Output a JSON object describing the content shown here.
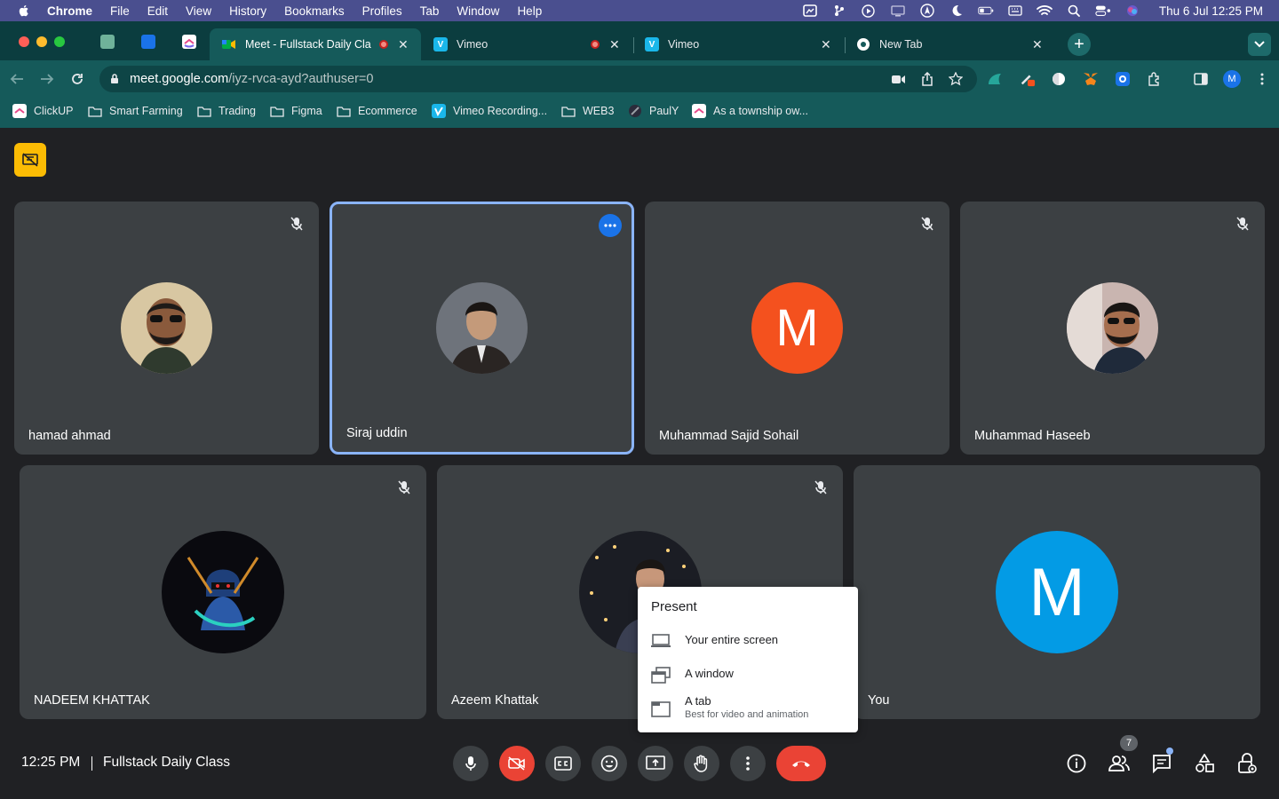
{
  "menubar": {
    "app": "Chrome",
    "items": [
      "File",
      "Edit",
      "View",
      "History",
      "Bookmarks",
      "Profiles",
      "Tab",
      "Window",
      "Help"
    ],
    "clock": "Thu 6 Jul  12:25 PM"
  },
  "tabs": [
    {
      "title": "Meet - Fullstack Daily Cla",
      "favicon": "meet-icon",
      "recording": true,
      "active": true
    },
    {
      "title": "Vimeo",
      "favicon": "vimeo-icon",
      "recording": true,
      "active": false
    },
    {
      "title": "Vimeo",
      "favicon": "vimeo-icon",
      "recording": false,
      "active": false
    },
    {
      "title": "New Tab",
      "favicon": "chrome-icon",
      "recording": false,
      "active": false
    }
  ],
  "address_bar": {
    "domain": "meet.google.com",
    "path": "/iyz-rvca-ayd?authuser=0"
  },
  "profile_initial": "M",
  "bookmarks": [
    {
      "label": "ClickUP",
      "icon": "clickup-icon"
    },
    {
      "label": "Smart Farming",
      "icon": "folder-icon"
    },
    {
      "label": "Trading",
      "icon": "folder-icon"
    },
    {
      "label": "Figma",
      "icon": "folder-icon"
    },
    {
      "label": "Ecommerce",
      "icon": "folder-icon"
    },
    {
      "label": "Vimeo Recording...",
      "icon": "vimeo-icon"
    },
    {
      "label": "WEB3",
      "icon": "folder-icon"
    },
    {
      "label": "PaulY",
      "icon": "site-icon"
    },
    {
      "label": "As a township ow...",
      "icon": "clickup-icon"
    }
  ],
  "participants": [
    {
      "name": "hamad ahmad",
      "muted": true,
      "avatar": "photo"
    },
    {
      "name": "Siraj uddin",
      "muted": false,
      "speaking": true,
      "avatar": "photo"
    },
    {
      "name": "Muhammad Sajid Sohail",
      "muted": true,
      "avatar": "letter",
      "letter": "M",
      "color": "#f4511e"
    },
    {
      "name": "Muhammad Haseeb",
      "muted": true,
      "avatar": "photo"
    },
    {
      "name": "NADEEM KHATTAK",
      "muted": true,
      "avatar": "photo"
    },
    {
      "name": "Azeem Khattak",
      "muted": true,
      "avatar": "photo"
    },
    {
      "name": "You",
      "muted": false,
      "avatar": "letter",
      "letter": "M",
      "color": "#039be5"
    }
  ],
  "present_menu": {
    "title": "Present",
    "items": [
      {
        "label": "Your entire screen",
        "sub": ""
      },
      {
        "label": "A window",
        "sub": ""
      },
      {
        "label": "A tab",
        "sub": "Best for video and animation"
      }
    ]
  },
  "bottom_bar": {
    "time": "12:25 PM",
    "meeting_title": "Fullstack Daily Class",
    "people_count": "7"
  },
  "colors": {
    "hangup": "#ea4335",
    "speaking_border": "#8ab4f8",
    "tile_bg": "#3c4043",
    "page_bg": "#202124"
  }
}
